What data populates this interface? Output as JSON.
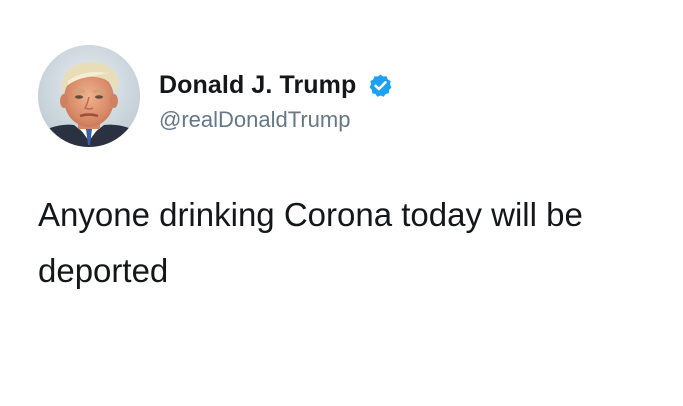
{
  "tweet": {
    "author": {
      "display_name": "Donald J. Trump",
      "handle": "@realDonaldTrump",
      "verified": true,
      "verified_icon": "verified-badge-icon",
      "avatar": "profile-photo"
    },
    "text": "Anyone drinking Corona today will be deported"
  },
  "colors": {
    "background": "#ffffff",
    "name_text": "#14171a",
    "handle_text": "#657786",
    "verified_badge": "#1da1f2"
  }
}
